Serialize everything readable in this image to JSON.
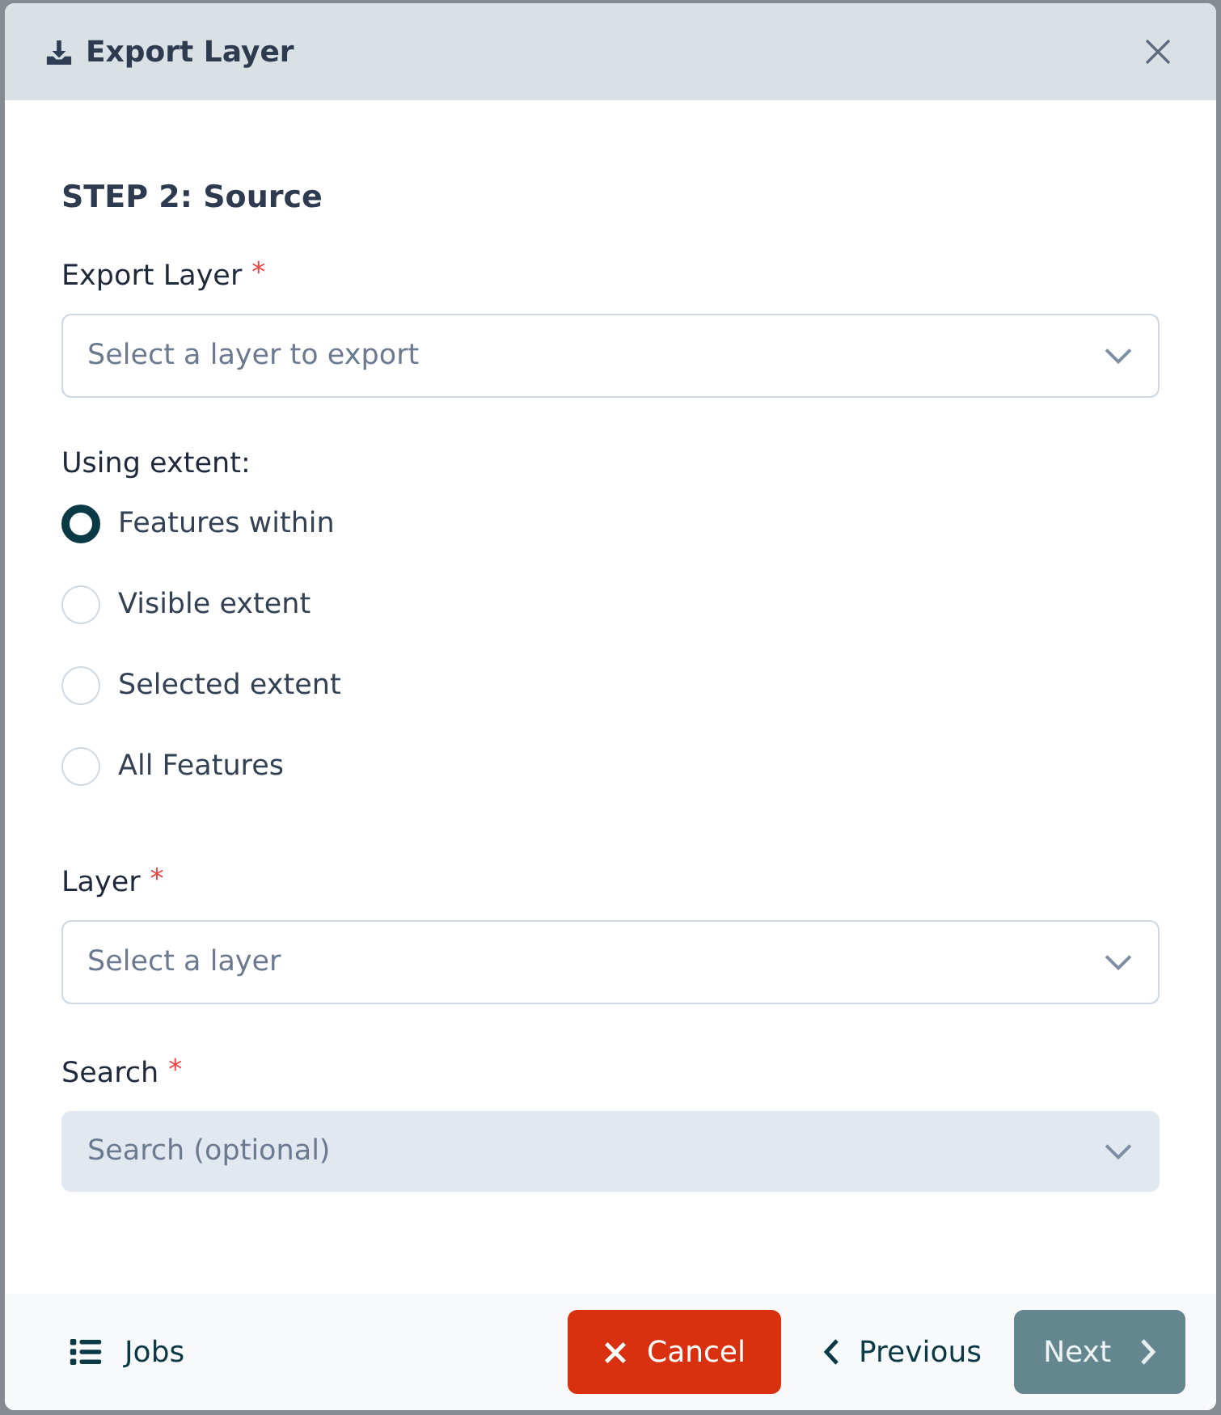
{
  "dialog": {
    "title": "Export Layer"
  },
  "step_title": "STEP 2: Source",
  "fields": [
    {
      "kind": "select",
      "label": "Export Layer",
      "required_mark": "*",
      "placeholder": "Select a layer to export",
      "disabled": false
    },
    {
      "kind": "radio_group",
      "label": "Using extent:",
      "options": [
        {
          "label": "Features within",
          "selected": true
        },
        {
          "label": "Visible extent",
          "selected": false
        },
        {
          "label": "Selected extent",
          "selected": false
        },
        {
          "label": "All Features",
          "selected": false
        }
      ]
    },
    {
      "kind": "select",
      "label": "Layer",
      "required_mark": "*",
      "placeholder": "Select a layer",
      "disabled": false
    },
    {
      "kind": "select",
      "label": "Search",
      "required_mark": "*",
      "placeholder": "Search (optional)",
      "disabled": true
    }
  ],
  "footer": {
    "jobs": {
      "label": "Jobs"
    },
    "buttons": [
      {
        "kind": "cancel",
        "label": "Cancel",
        "disabled": false
      },
      {
        "kind": "previous",
        "label": "Previous",
        "disabled": false
      },
      {
        "kind": "next",
        "label": "Next",
        "disabled": true
      }
    ]
  }
}
